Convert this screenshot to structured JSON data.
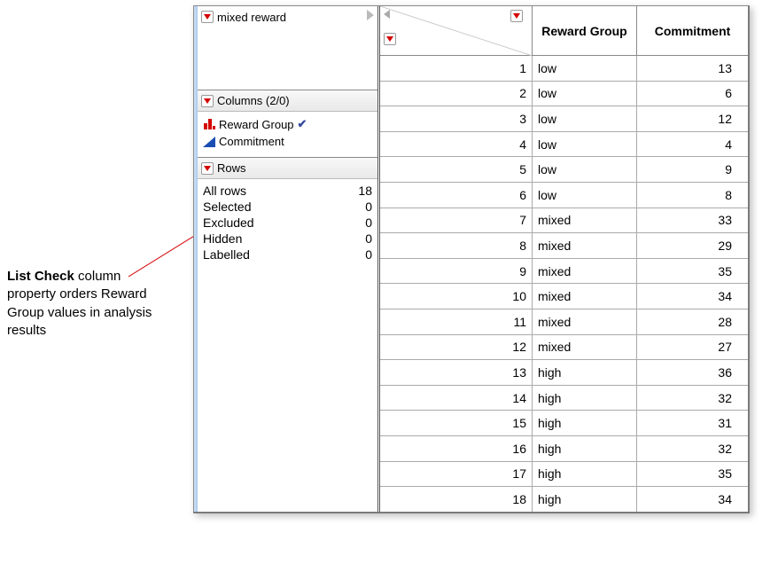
{
  "annotation": {
    "strong": "List Check",
    "rest": "column property orders Reward Group values in analysis results"
  },
  "tablePanel": {
    "title": "mixed reward"
  },
  "columnsPanel": {
    "title": "Columns (2/0)",
    "items": [
      {
        "label": "Reward Group",
        "icon": "bars",
        "checked": true
      },
      {
        "label": "Commitment",
        "icon": "ramp",
        "checked": false
      }
    ]
  },
  "rowsPanel": {
    "title": "Rows",
    "stats": [
      {
        "label": "All rows",
        "value": 18
      },
      {
        "label": "Selected",
        "value": 0
      },
      {
        "label": "Excluded",
        "value": 0
      },
      {
        "label": "Hidden",
        "value": 0
      },
      {
        "label": "Labelled",
        "value": 0
      }
    ]
  },
  "grid": {
    "headers": {
      "c1": "Reward Group",
      "c2": "Commitment"
    },
    "rows": [
      {
        "idx": 1,
        "group": "low",
        "commit": 13
      },
      {
        "idx": 2,
        "group": "low",
        "commit": 6
      },
      {
        "idx": 3,
        "group": "low",
        "commit": 12
      },
      {
        "idx": 4,
        "group": "low",
        "commit": 4
      },
      {
        "idx": 5,
        "group": "low",
        "commit": 9
      },
      {
        "idx": 6,
        "group": "low",
        "commit": 8
      },
      {
        "idx": 7,
        "group": "mixed",
        "commit": 33
      },
      {
        "idx": 8,
        "group": "mixed",
        "commit": 29
      },
      {
        "idx": 9,
        "group": "mixed",
        "commit": 35
      },
      {
        "idx": 10,
        "group": "mixed",
        "commit": 34
      },
      {
        "idx": 11,
        "group": "mixed",
        "commit": 28
      },
      {
        "idx": 12,
        "group": "mixed",
        "commit": 27
      },
      {
        "idx": 13,
        "group": "high",
        "commit": 36
      },
      {
        "idx": 14,
        "group": "high",
        "commit": 32
      },
      {
        "idx": 15,
        "group": "high",
        "commit": 31
      },
      {
        "idx": 16,
        "group": "high",
        "commit": 32
      },
      {
        "idx": 17,
        "group": "high",
        "commit": 35
      },
      {
        "idx": 18,
        "group": "high",
        "commit": 34
      }
    ]
  }
}
